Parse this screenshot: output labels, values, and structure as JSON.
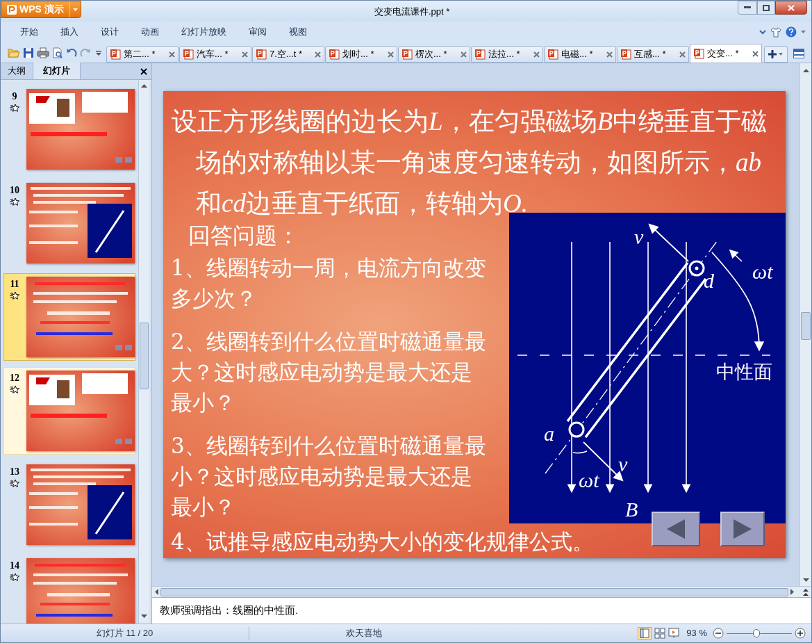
{
  "window": {
    "app_button": "WPS 演示",
    "title": "交变电流课件.ppt *"
  },
  "menu": [
    "开始",
    "插入",
    "设计",
    "动画",
    "幻灯片放映",
    "审阅",
    "视图"
  ],
  "doc_tabs": [
    {
      "label": "第二... *",
      "selected": false
    },
    {
      "label": "汽车... *",
      "selected": false
    },
    {
      "label": "7.空...t *",
      "selected": false
    },
    {
      "label": "划时... *",
      "selected": false
    },
    {
      "label": "楞次... *",
      "selected": false
    },
    {
      "label": "法拉... *",
      "selected": false
    },
    {
      "label": "电磁... *",
      "selected": false
    },
    {
      "label": "互感... *",
      "selected": false
    },
    {
      "label": "交变... *",
      "selected": true
    }
  ],
  "panel_tabs": [
    {
      "label": "大纲",
      "selected": false
    },
    {
      "label": "幻灯片",
      "selected": true
    }
  ],
  "thumbnails": [
    {
      "number": "9",
      "selected": false,
      "highlighted": false
    },
    {
      "number": "10",
      "selected": false,
      "highlighted": false
    },
    {
      "number": "11",
      "selected": true,
      "highlighted": false
    },
    {
      "number": "12",
      "selected": false,
      "highlighted": true
    },
    {
      "number": "13",
      "selected": false,
      "highlighted": false
    },
    {
      "number": "14",
      "selected": false,
      "highlighted": false
    }
  ],
  "slide": {
    "title": [
      {
        "text": "设正方形线圈的边长为",
        "italic": false
      },
      {
        "text": "L",
        "italic": true
      },
      {
        "text": "，在匀强磁场",
        "italic": false
      },
      {
        "text": "B",
        "italic": true
      },
      {
        "text": "中绕垂直于磁场的对称轴以某一角速度匀速转动，如图所示，",
        "italic": false
      },
      {
        "text": "ab",
        "italic": true
      },
      {
        "text": "和",
        "italic": false
      },
      {
        "text": "cd",
        "italic": true
      },
      {
        "text": "边垂直于纸面，转轴为",
        "italic": false
      },
      {
        "text": "O.",
        "italic": true
      }
    ],
    "prompt": "回答问题：",
    "questions": [
      "1、线圈转动一周，电流方向改变多少次？",
      "2、线圈转到什么位置时磁通量最大？这时感应电动势是最大还是最小？",
      "3、线圈转到什么位置时磁通量最小？这时感应电动势是最大还是最小？"
    ],
    "last_question": "4、试推导感应电动势大小的变化规律公式。",
    "diagram_labels": [
      "v",
      "d",
      "ωt",
      "中性面",
      "a",
      "v",
      "ωt",
      "B"
    ]
  },
  "notes": "教师强调指出：线圈的中性面.",
  "status_bar": {
    "slide_counter": "幻灯片 11 / 20",
    "theme": "欢天喜地",
    "zoom": "93 %",
    "zoom_slider": {
      "level": 0.45
    }
  }
}
